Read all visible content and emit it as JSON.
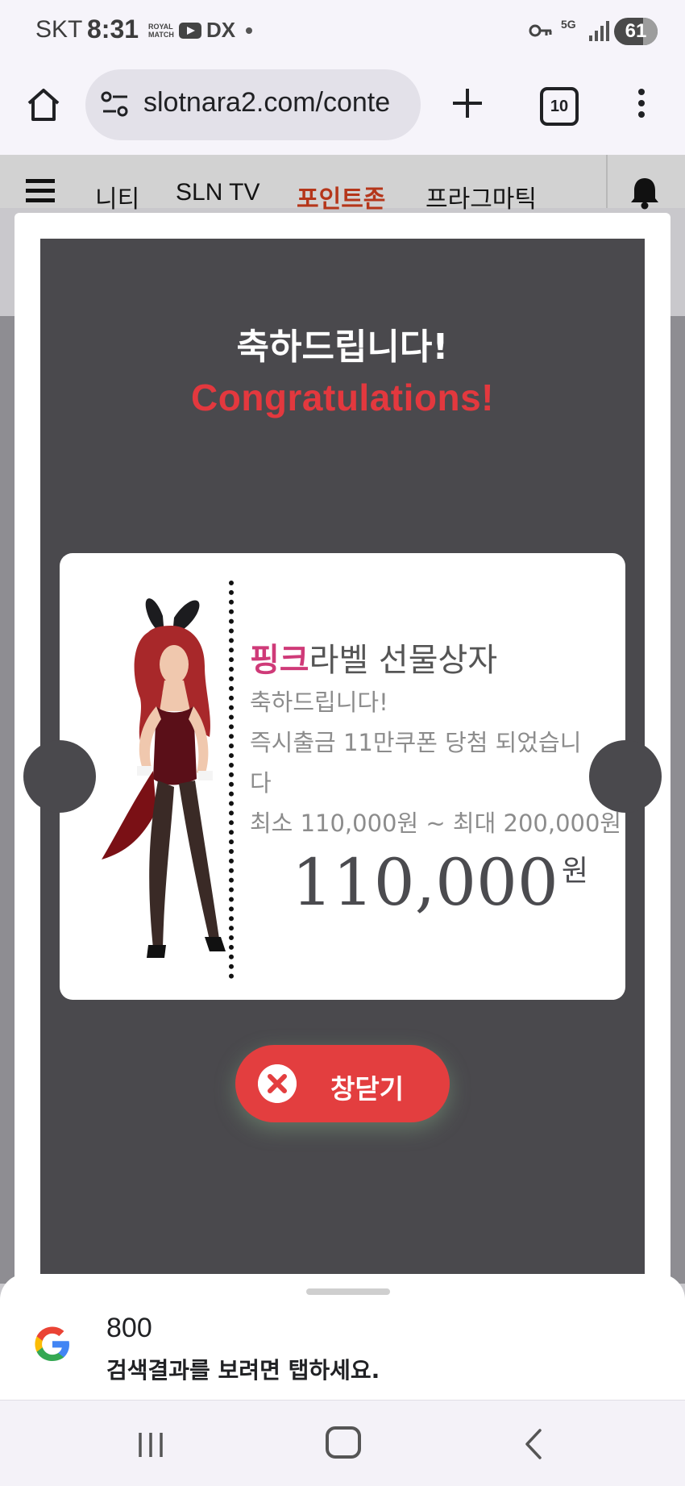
{
  "status_bar": {
    "carrier": "SKT",
    "time": "8:31",
    "royal_match_line1": "ROYAL",
    "royal_match_line2": "MATCH",
    "dx_label": "DX",
    "network": "5G",
    "battery": "61"
  },
  "browser": {
    "url": "slotnara2.com/conte",
    "tab_count": "10"
  },
  "site_nav": {
    "items": [
      {
        "label": "니티",
        "active": false
      },
      {
        "label": "SLN TV",
        "active": false
      },
      {
        "label": "포인트존",
        "active": true
      },
      {
        "label": "프라그마틱",
        "active": false
      }
    ]
  },
  "modal": {
    "title_ko": "축하드립니다!",
    "title_en": "Congratulations!",
    "card": {
      "title_highlight": "핑크",
      "title_rest": "라벨 선물상자",
      "line1": "축하드립니다!",
      "line2a": "즉시출금 11만쿠폰 당첨 되었습니",
      "line2b": "다",
      "range": "최소 110,000원 ~ 최대 200,000원",
      "amount": "110,000",
      "amount_unit": "원"
    },
    "close_label": "창닫기"
  },
  "google_sheet": {
    "term": "800",
    "hint": "검색결과를 보려면 탭하세요."
  },
  "colors": {
    "accent_red": "#e3383e",
    "highlight_pink": "#cf3a78",
    "active_nav": "#b5361a",
    "modal_bg": "#4a494d"
  }
}
